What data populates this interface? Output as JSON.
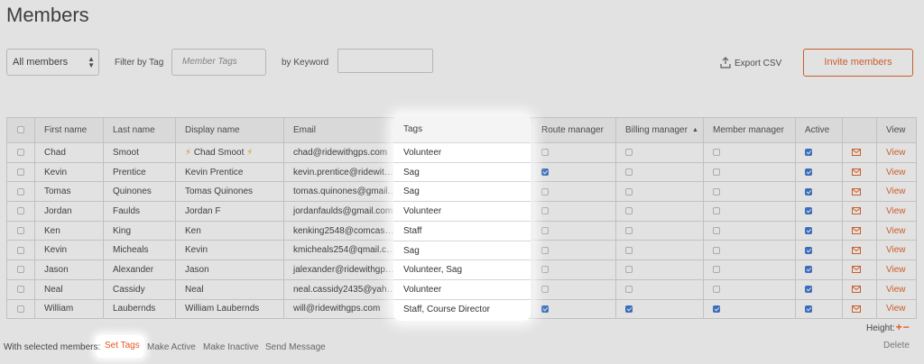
{
  "page": {
    "title": "Members"
  },
  "filters": {
    "scope_value": "All members",
    "tag_label": "Filter by Tag",
    "tag_placeholder": "Member Tags",
    "keyword_label": "by Keyword",
    "keyword_value": ""
  },
  "toolbar": {
    "export_label": "Export CSV",
    "invite_label": "Invite members"
  },
  "table": {
    "headers": {
      "first_name": "First name",
      "last_name": "Last name",
      "display_name": "Display name",
      "email": "Email",
      "tags": "Tags",
      "route_manager": "Route manager",
      "billing_manager": "Billing manager",
      "member_manager": "Member manager",
      "active": "Active",
      "view": "View"
    },
    "sorted_column": "billing_manager",
    "sort_direction": "asc",
    "rows": [
      {
        "first": "Chad",
        "last": "Smoot",
        "display": "Chad Smoot",
        "display_bolts": true,
        "email": "chad@ridewithgps.com",
        "tags": "Volunteer",
        "route": false,
        "billing": false,
        "member": false,
        "active": true,
        "view": "View"
      },
      {
        "first": "Kevin",
        "last": "Prentice",
        "display": "Kevin Prentice",
        "display_bolts": false,
        "email": "kevin.prentice@ridewit…",
        "tags": "Sag",
        "route": true,
        "billing": false,
        "member": false,
        "active": true,
        "view": "View"
      },
      {
        "first": "Tomas",
        "last": "Quinones",
        "display": "Tomas Quinones",
        "display_bolts": false,
        "email": "tomas.quinones@gmail.…",
        "tags": "Sag",
        "route": false,
        "billing": false,
        "member": false,
        "active": true,
        "view": "View"
      },
      {
        "first": "Jordan",
        "last": "Faulds",
        "display": "Jordan F",
        "display_bolts": false,
        "email": "jordanfaulds@gmail.com",
        "tags": "Volunteer",
        "route": false,
        "billing": false,
        "member": false,
        "active": true,
        "view": "View"
      },
      {
        "first": "Ken",
        "last": "King",
        "display": "Ken",
        "display_bolts": false,
        "email": "kenking2548@comcas…",
        "tags": "Staff",
        "route": false,
        "billing": false,
        "member": false,
        "active": true,
        "view": "View"
      },
      {
        "first": "Kevin",
        "last": "Micheals",
        "display": "Kevin",
        "display_bolts": false,
        "email": "kmicheals254@qmail.c…",
        "tags": "Sag",
        "route": false,
        "billing": false,
        "member": false,
        "active": true,
        "view": "View"
      },
      {
        "first": "Jason",
        "last": "Alexander",
        "display": "Jason",
        "display_bolts": false,
        "email": "jalexander@ridewithgp…",
        "tags": "Volunteer, Sag",
        "route": false,
        "billing": false,
        "member": false,
        "active": true,
        "view": "View"
      },
      {
        "first": "Neal",
        "last": "Cassidy",
        "display": "Neal",
        "display_bolts": false,
        "email": "neal.cassidy2435@yah…",
        "tags": "Volunteer",
        "route": false,
        "billing": false,
        "member": false,
        "active": true,
        "view": "View"
      },
      {
        "first": "William",
        "last": "Laubernds",
        "display": "William Laubernds",
        "display_bolts": false,
        "email": "will@ridewithgps.com",
        "tags": "Staff, Course Director",
        "route": true,
        "billing": true,
        "member": true,
        "active": true,
        "view": "View"
      }
    ]
  },
  "height_control": {
    "label": "Height:",
    "plus": "+",
    "minus": "−"
  },
  "bulk": {
    "label": "With selected members:",
    "actions": [
      "Set Tags",
      "Make Active",
      "Make Inactive",
      "Send Message"
    ],
    "delete_label": "Delete"
  },
  "colors": {
    "accent": "#e25a1c",
    "checkbox": "#2f6fce",
    "overlay": "rgba(110,110,110,0.2)"
  },
  "icons": {
    "export": "upload-icon",
    "message": "envelope-icon",
    "bolt": "lightning-bolt-icon",
    "sort": "sort-ascending-icon"
  }
}
